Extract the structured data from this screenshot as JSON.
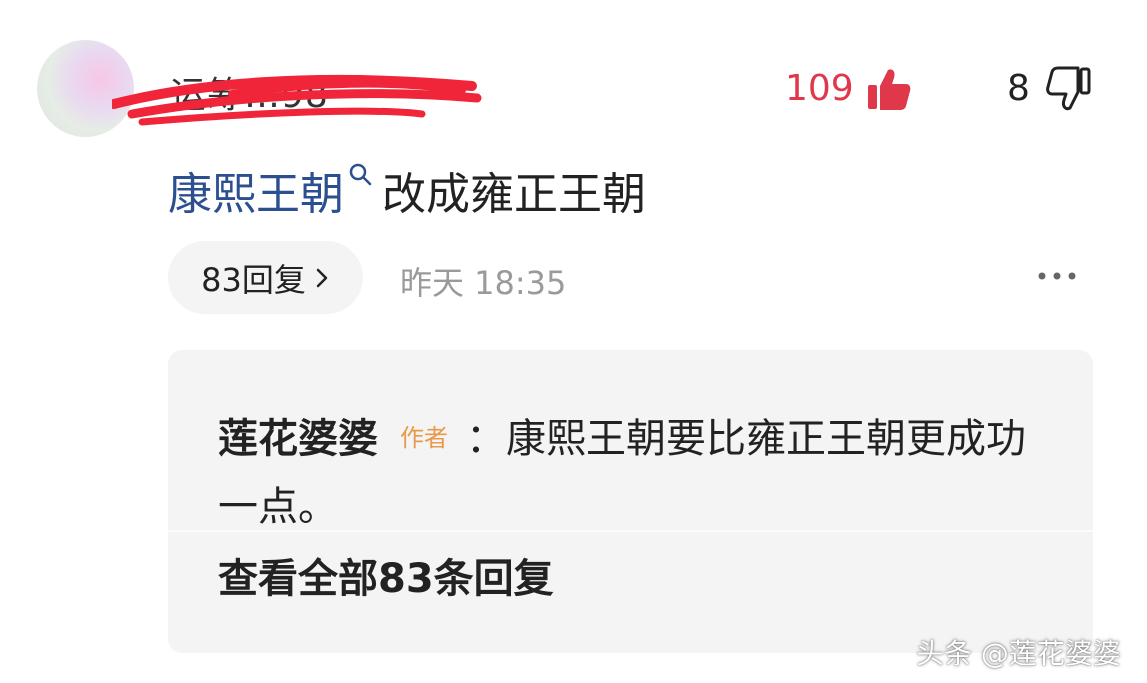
{
  "comment": {
    "username_visible": "运筹…98",
    "likes": "109",
    "dislikes": "8",
    "topic_link": "康熙王朝",
    "text": "改成雍正王朝",
    "reply_button": "83回复",
    "timestamp": "昨天 18:35"
  },
  "reply": {
    "author": "莲花婆婆",
    "author_tag": "作者",
    "separator": "：",
    "text": "康熙王朝要比雍正王朝更成功一点。",
    "view_all": "查看全部83条回复"
  },
  "watermark": "头条 @莲花婆婆",
  "colors": {
    "like_red": "#e0384b",
    "topic_blue": "#2c4f8f",
    "author_tag_orange": "#e89a4a",
    "scribble_red": "#f0253a"
  },
  "icons": {
    "like": "thumbs-up-icon",
    "dislike": "thumbs-down-icon",
    "search": "search-icon",
    "chevron": "chevron-right-icon",
    "more": "more-dots-icon"
  }
}
